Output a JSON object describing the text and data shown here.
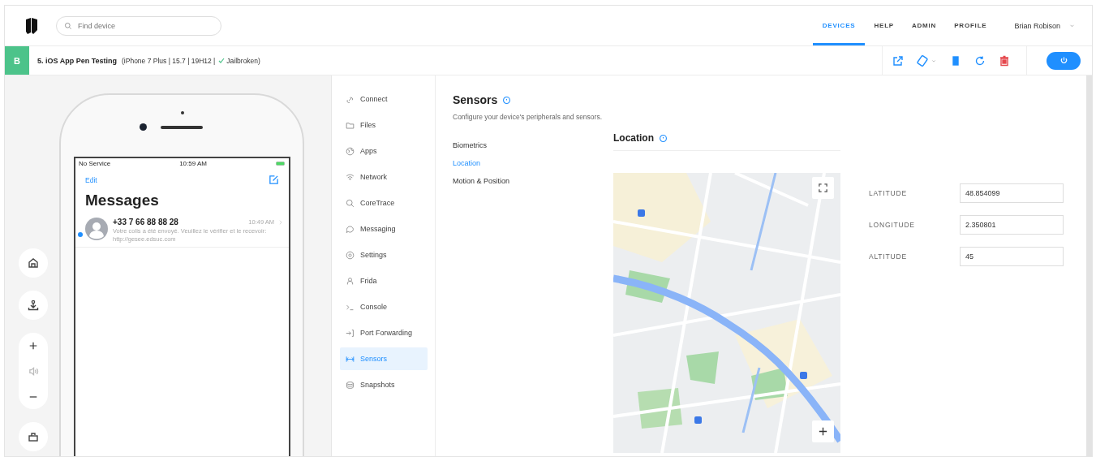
{
  "header": {
    "search": {
      "placeholder": "Find device"
    },
    "tabs": [
      {
        "label": "DEVICES",
        "selected": true
      },
      {
        "label": "HELP",
        "selected": false
      },
      {
        "label": "ADMIN",
        "selected": false
      },
      {
        "label": "PROFILE",
        "selected": false
      }
    ],
    "user": "Brian Robison"
  },
  "device_bar": {
    "badge": "B",
    "name": "5. iOS App Pen Testing",
    "details": "(iPhone 7 Plus | 15.7 | 19H12 |",
    "jailbroken": true,
    "status": "Jailbroken)"
  },
  "phone": {
    "carrier": "No Service",
    "time": "10:59 AM",
    "edit": "Edit",
    "title": "Messages",
    "messages": [
      {
        "sender": "+33 7 66 88 88 28",
        "time": "10:49 AM",
        "preview": "Votre colis a été envoyé. Veuillez le vérifier et le recevoir: http://gesee.edsuc.com",
        "unread": true
      }
    ]
  },
  "nav": [
    {
      "label": "Connect",
      "selected": false
    },
    {
      "label": "Files",
      "selected": false
    },
    {
      "label": "Apps",
      "selected": false
    },
    {
      "label": "Network",
      "selected": false
    },
    {
      "label": "CoreTrace",
      "selected": false
    },
    {
      "label": "Messaging",
      "selected": false
    },
    {
      "label": "Settings",
      "selected": false
    },
    {
      "label": "Frida",
      "selected": false
    },
    {
      "label": "Console",
      "selected": false
    },
    {
      "label": "Port Forwarding",
      "selected": false
    },
    {
      "label": "Sensors",
      "selected": true
    },
    {
      "label": "Snapshots",
      "selected": false
    }
  ],
  "sensors": {
    "title": "Sensors",
    "description": "Configure your device's peripherals and sensors.",
    "subnav": [
      {
        "label": "Biometrics",
        "selected": false
      },
      {
        "label": "Location",
        "selected": true
      },
      {
        "label": "Motion & Position",
        "selected": false
      }
    ],
    "location": {
      "title": "Location",
      "fields": [
        {
          "label": "LATITUDE",
          "value": "48.854099"
        },
        {
          "label": "LONGITUDE",
          "value": "2.350801"
        },
        {
          "label": "ALTITUDE",
          "value": "45"
        }
      ]
    }
  }
}
